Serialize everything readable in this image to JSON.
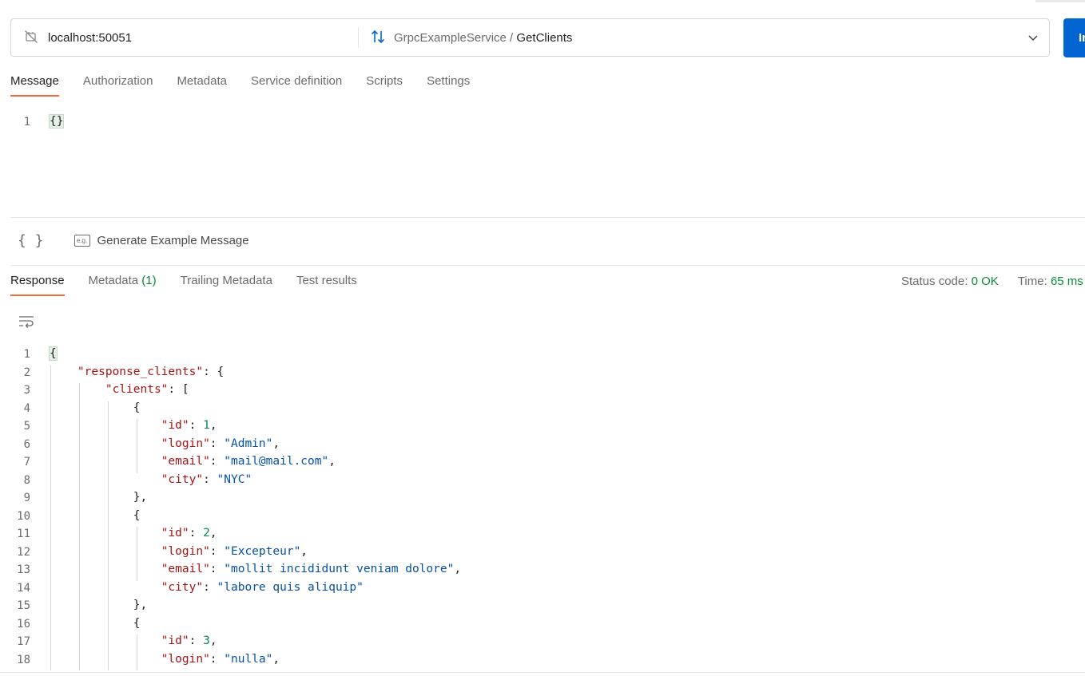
{
  "request": {
    "url": "localhost:50051",
    "service": "GrpcExampleService",
    "separator": " / ",
    "method": "GetClients",
    "invoke_label": "Invoke"
  },
  "request_tabs": [
    "Message",
    "Authorization",
    "Metadata",
    "Service definition",
    "Scripts",
    "Settings"
  ],
  "message_editor": {
    "lines": [
      "{}"
    ]
  },
  "message_tools": {
    "generate_label": "Generate Example Message",
    "example_icon_text": "e.g."
  },
  "response_tabs": [
    {
      "label": "Response"
    },
    {
      "label": "Metadata",
      "count": "(1)"
    },
    {
      "label": "Trailing Metadata"
    },
    {
      "label": "Test results"
    }
  ],
  "status": {
    "code_label": "Status code:",
    "code_value": "0 OK",
    "time_label": "Time:",
    "time_value": "65 ms"
  },
  "response_editor": {
    "lines": [
      "{",
      "    \"response_clients\": {",
      "        \"clients\": [",
      "            {",
      "                \"id\": 1,",
      "                \"login\": \"Admin\",",
      "                \"email\": \"mail@mail.com\",",
      "                \"city\": \"NYC\"",
      "            },",
      "            {",
      "                \"id\": 2,",
      "                \"login\": \"Excepteur\",",
      "                \"email\": \"mollit incididunt veniam dolore\",",
      "                \"city\": \"labore quis aliquip\"",
      "            },",
      "            {",
      "                \"id\": 3,",
      "                \"login\": \"nulla\","
    ]
  },
  "colors": {
    "accent_tab": "#f26b3a",
    "invoke_button": "#0265d2",
    "status_ok": "#0c8a3a"
  },
  "icons": [
    "connection-off-icon",
    "grpc-arrows-icon",
    "chevron-down-icon",
    "braces-icon",
    "example-icon",
    "wrap-lines-icon"
  ]
}
